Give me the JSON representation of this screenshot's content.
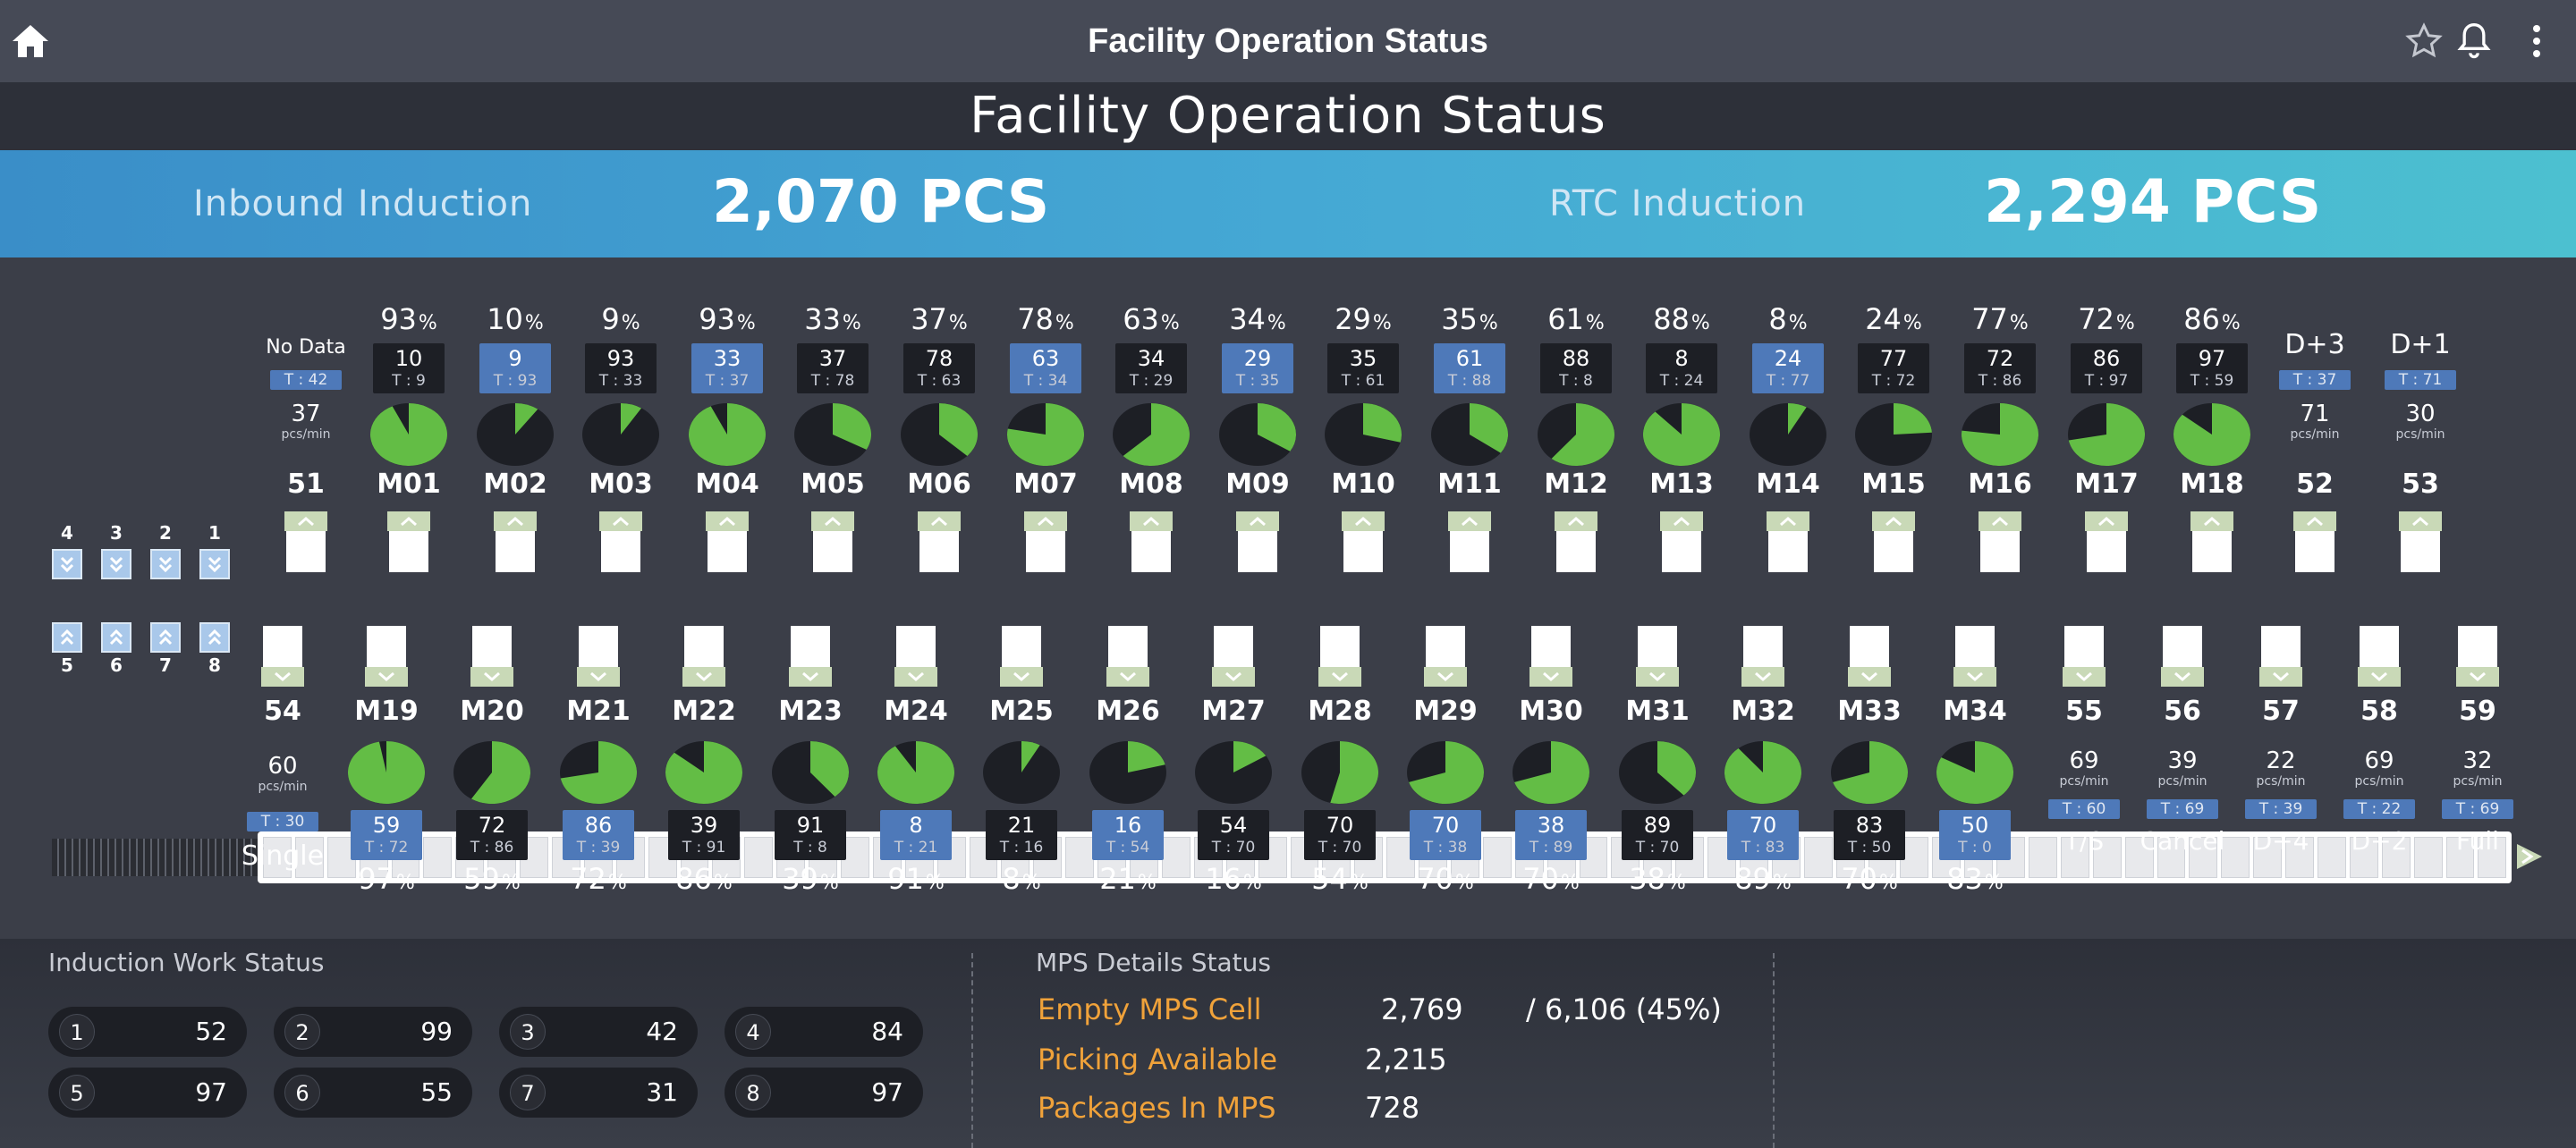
{
  "appbar": {
    "title": "Facility Operation Status"
  },
  "page": {
    "heading": "Facility Operation Status"
  },
  "induction": {
    "inbound_label": "Inbound Induction",
    "inbound_value": "2,070 PCS",
    "rtc_label": "RTC Induction",
    "rtc_value": "2,294 PCS"
  },
  "colors": {
    "pie_green": "#63bd45",
    "pie_dark": "#1d1f25",
    "accent_blue": "#4e79b9"
  },
  "top_left_station": {
    "label": "51",
    "status": "No Data",
    "t": "T : 42",
    "rate": "37",
    "rate_unit": "pcs/min"
  },
  "top_machines": [
    {
      "label": "M01",
      "pct": "93",
      "value": "10",
      "t": "T : 9",
      "box": "dark",
      "fill": 0.93
    },
    {
      "label": "M02",
      "pct": "10",
      "value": "9",
      "t": "T : 93",
      "box": "blue",
      "fill": 0.1
    },
    {
      "label": "M03",
      "pct": "9",
      "value": "93",
      "t": "T : 33",
      "box": "dark",
      "fill": 0.09
    },
    {
      "label": "M04",
      "pct": "93",
      "value": "33",
      "t": "T : 37",
      "box": "blue",
      "fill": 0.93
    },
    {
      "label": "M05",
      "pct": "33",
      "value": "37",
      "t": "T : 78",
      "box": "dark",
      "fill": 0.33
    },
    {
      "label": "M06",
      "pct": "37",
      "value": "78",
      "t": "T : 63",
      "box": "dark",
      "fill": 0.37
    },
    {
      "label": "M07",
      "pct": "78",
      "value": "63",
      "t": "T : 34",
      "box": "blue",
      "fill": 0.78
    },
    {
      "label": "M08",
      "pct": "63",
      "value": "34",
      "t": "T : 29",
      "box": "dark",
      "fill": 0.63
    },
    {
      "label": "M09",
      "pct": "34",
      "value": "29",
      "t": "T : 35",
      "box": "blue",
      "fill": 0.34
    },
    {
      "label": "M10",
      "pct": "29",
      "value": "35",
      "t": "T : 61",
      "box": "dark",
      "fill": 0.29
    },
    {
      "label": "M11",
      "pct": "35",
      "value": "61",
      "t": "T : 88",
      "box": "blue",
      "fill": 0.35
    },
    {
      "label": "M12",
      "pct": "61",
      "value": "88",
      "t": "T : 8",
      "box": "dark",
      "fill": 0.61
    },
    {
      "label": "M13",
      "pct": "88",
      "value": "8",
      "t": "T : 24",
      "box": "dark",
      "fill": 0.88
    },
    {
      "label": "M14",
      "pct": "8",
      "value": "24",
      "t": "T : 77",
      "box": "blue",
      "fill": 0.08
    },
    {
      "label": "M15",
      "pct": "24",
      "value": "77",
      "t": "T : 72",
      "box": "dark",
      "fill": 0.24
    },
    {
      "label": "M16",
      "pct": "77",
      "value": "72",
      "t": "T : 86",
      "box": "dark",
      "fill": 0.77
    },
    {
      "label": "M17",
      "pct": "72",
      "value": "86",
      "t": "T : 97",
      "box": "dark",
      "fill": 0.72
    },
    {
      "label": "M18",
      "pct": "86",
      "value": "97",
      "t": "T : 59",
      "box": "dark",
      "fill": 0.86
    }
  ],
  "top_right_stations": [
    {
      "label": "52",
      "word": "D+3",
      "t": "T : 37",
      "rate": "71",
      "rate_unit": "pcs/min"
    },
    {
      "label": "53",
      "word": "D+1",
      "t": "T : 71",
      "rate": "30",
      "rate_unit": "pcs/min"
    }
  ],
  "bottom_left_station": {
    "label": "54",
    "rate": "60",
    "rate_unit": "pcs/min",
    "t": "T : 30",
    "word": "Single"
  },
  "bottom_machines": [
    {
      "label": "M19",
      "pct": "97",
      "value": "59",
      "t": "T : 72",
      "box": "blue",
      "fill": 0.97
    },
    {
      "label": "M20",
      "pct": "59",
      "value": "72",
      "t": "T : 86",
      "box": "dark",
      "fill": 0.59
    },
    {
      "label": "M21",
      "pct": "72",
      "value": "86",
      "t": "T : 39",
      "box": "blue",
      "fill": 0.72
    },
    {
      "label": "M22",
      "pct": "86",
      "value": "39",
      "t": "T : 91",
      "box": "dark",
      "fill": 0.86
    },
    {
      "label": "M23",
      "pct": "39",
      "value": "91",
      "t": "T : 8",
      "box": "dark",
      "fill": 0.39
    },
    {
      "label": "M24",
      "pct": "91",
      "value": "8",
      "t": "T : 21",
      "box": "blue",
      "fill": 0.91
    },
    {
      "label": "M25",
      "pct": "8",
      "value": "21",
      "t": "T : 16",
      "box": "dark",
      "fill": 0.08
    },
    {
      "label": "M26",
      "pct": "21",
      "value": "16",
      "t": "T : 54",
      "box": "blue",
      "fill": 0.21
    },
    {
      "label": "M27",
      "pct": "16",
      "value": "54",
      "t": "T : 70",
      "box": "dark",
      "fill": 0.16
    },
    {
      "label": "M28",
      "pct": "54",
      "value": "70",
      "t": "T : 70",
      "box": "dark",
      "fill": 0.54
    },
    {
      "label": "M29",
      "pct": "70",
      "value": "70",
      "t": "T : 38",
      "box": "blue",
      "fill": 0.7
    },
    {
      "label": "M30",
      "pct": "70",
      "value": "38",
      "t": "T : 89",
      "box": "blue",
      "fill": 0.7
    },
    {
      "label": "M31",
      "pct": "38",
      "value": "89",
      "t": "T : 70",
      "box": "dark",
      "fill": 0.38
    },
    {
      "label": "M32",
      "pct": "89",
      "value": "70",
      "t": "T : 83",
      "box": "blue",
      "fill": 0.89
    },
    {
      "label": "M33",
      "pct": "70",
      "value": "83",
      "t": "T : 50",
      "box": "dark",
      "fill": 0.7
    },
    {
      "label": "M34",
      "pct": "83",
      "value": "50",
      "t": "T : 0",
      "box": "blue",
      "fill": 0.83
    }
  ],
  "bottom_right_stations": [
    {
      "label": "55",
      "rate": "69",
      "rate_unit": "pcs/min",
      "t": "T : 60",
      "word": "T/S"
    },
    {
      "label": "56",
      "rate": "39",
      "rate_unit": "pcs/min",
      "t": "T : 69",
      "word": "Cancel"
    },
    {
      "label": "57",
      "rate": "22",
      "rate_unit": "pcs/min",
      "t": "T : 39",
      "word": "D+4"
    },
    {
      "label": "58",
      "rate": "69",
      "rate_unit": "pcs/min",
      "t": "T : 22",
      "word": "D+2"
    },
    {
      "label": "59",
      "rate": "32",
      "rate_unit": "pcs/min",
      "t": "T : 69",
      "word": "Full"
    }
  ],
  "sorters_top": [
    "4",
    "3",
    "2",
    "1"
  ],
  "sorters_bottom": [
    "5",
    "6",
    "7",
    "8"
  ],
  "work_status": {
    "title": "Induction Work Status",
    "items": [
      {
        "n": "1",
        "v": "52"
      },
      {
        "n": "2",
        "v": "99"
      },
      {
        "n": "3",
        "v": "42"
      },
      {
        "n": "4",
        "v": "84"
      },
      {
        "n": "5",
        "v": "97"
      },
      {
        "n": "6",
        "v": "55"
      },
      {
        "n": "7",
        "v": "31"
      },
      {
        "n": "8",
        "v": "97"
      }
    ]
  },
  "mps": {
    "title": "MPS Details Status",
    "empty_label": "Empty MPS Cell",
    "empty_value": "2,769",
    "empty_total": "/ 6,106 (45%)",
    "picking_label": "Picking Available",
    "picking_value": "2,215",
    "packages_label": "Packages In MPS",
    "packages_value": "728"
  },
  "percent_unit": "%"
}
